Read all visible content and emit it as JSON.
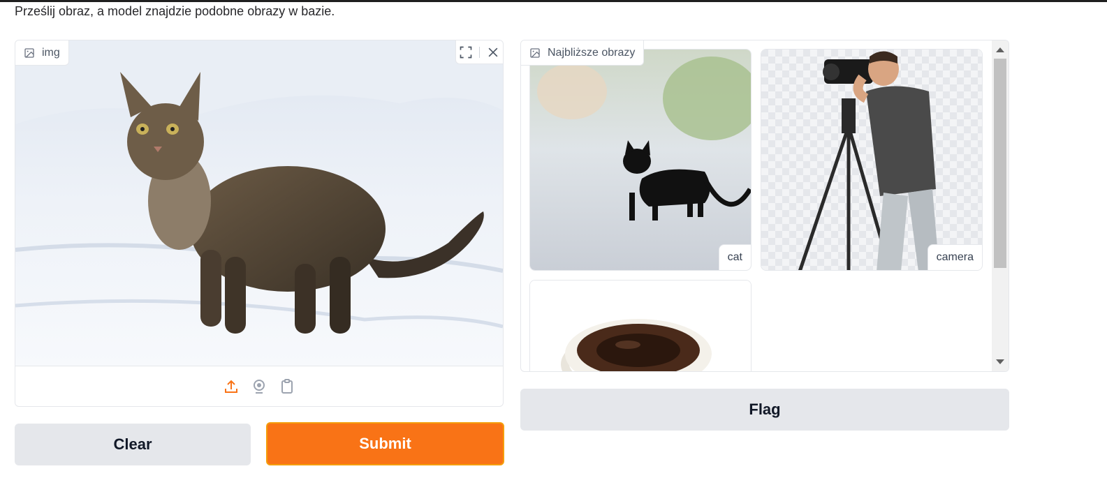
{
  "description": "Prześlij obraz, a model znajdzie podobne obrazy w bazie.",
  "input": {
    "label": "img",
    "icons": [
      "fullscreen-icon",
      "close-icon"
    ],
    "sources": [
      "upload-icon",
      "webcam-icon",
      "clipboard-icon"
    ]
  },
  "gallery": {
    "label": "Najbliższe obrazy",
    "items": [
      {
        "caption": "cat"
      },
      {
        "caption": "camera"
      },
      {
        "caption": ""
      }
    ]
  },
  "buttons": {
    "clear": "Clear",
    "submit": "Submit",
    "flag": "Flag"
  },
  "colors": {
    "accent": "#f97316",
    "button_gray": "#e5e7eb"
  }
}
